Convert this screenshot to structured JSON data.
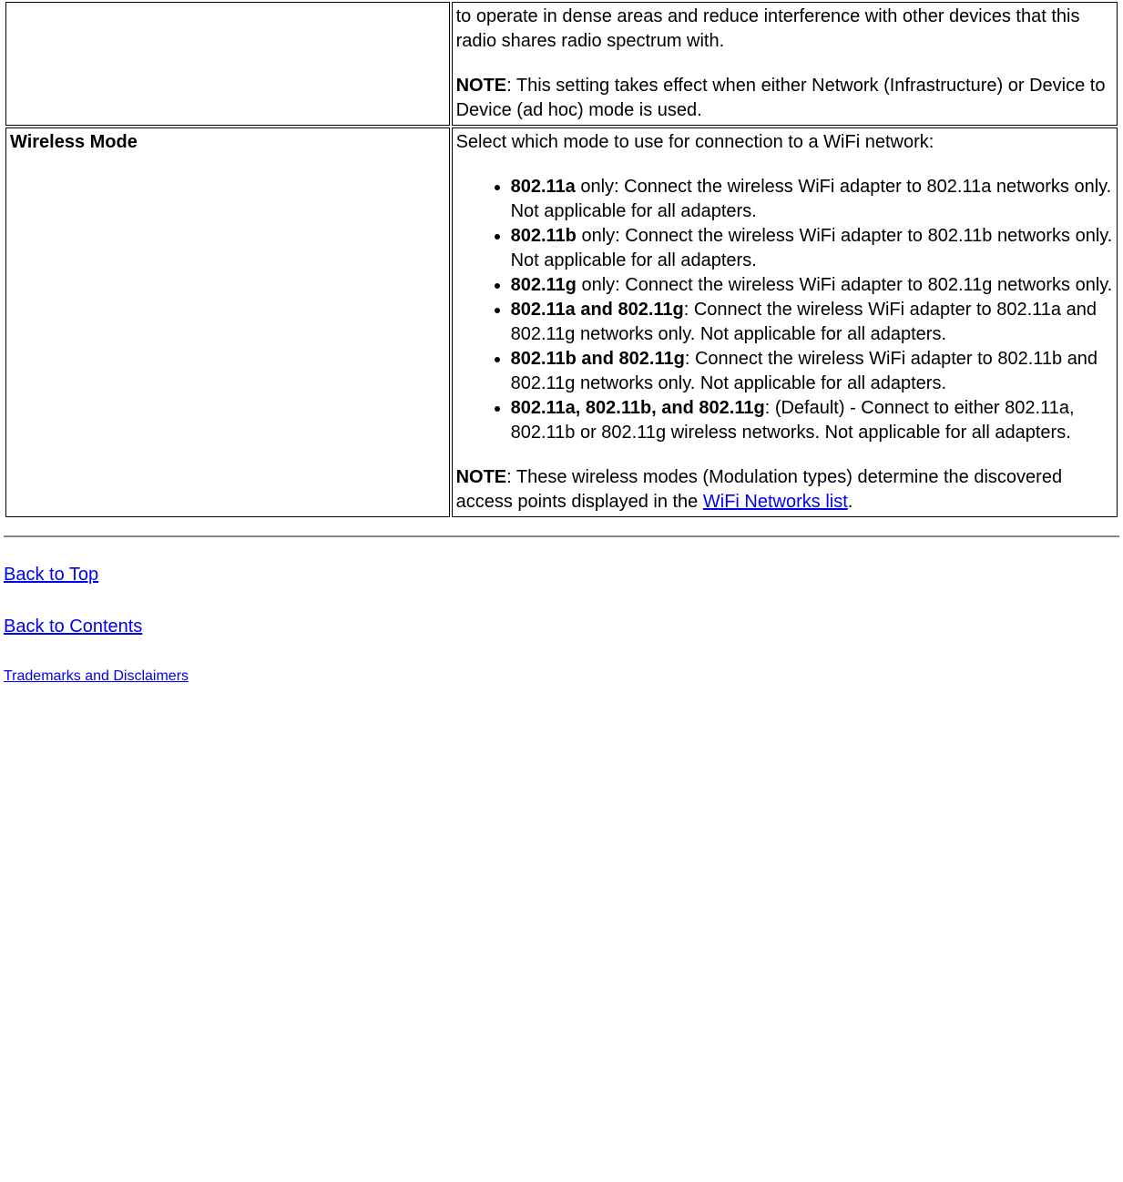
{
  "table": {
    "row1": {
      "name": "",
      "desc_part1": "to operate in dense areas and reduce interference with other devices that this radio shares radio spectrum with.",
      "note_label": "NOTE",
      "note_text": ": This setting takes effect when either Network (Infrastructure) or Device to Device (ad hoc) mode is used."
    },
    "row2": {
      "name": "Wireless Mode",
      "intro": "Select which mode to use for connection to a WiFi network:",
      "items": [
        {
          "bold": "802.11a",
          "rest": " only: Connect the wireless WiFi adapter to 802.11a networks only. Not applicable for all adapters."
        },
        {
          "bold": "802.11b",
          "rest": " only: Connect the wireless WiFi adapter to 802.11b networks only. Not applicable for all adapters."
        },
        {
          "bold": "802.11g",
          "rest": " only: Connect the wireless WiFi adapter to 802.11g networks only."
        },
        {
          "bold": "802.11a and 802.11g",
          "rest": ": Connect the wireless WiFi adapter to 802.11a and 802.11g networks only. Not applicable for all adapters."
        },
        {
          "bold": "802.11b and 802.11g",
          "rest": ": Connect the wireless WiFi adapter to 802.11b and 802.11g networks only. Not applicable for all adapters."
        },
        {
          "bold": "802.11a, 802.11b, and 802.11g",
          "rest": ": (Default) - Connect to either 802.11a, 802.11b or 802.11g wireless networks. Not applicable for all adapters."
        }
      ],
      "note_label": "NOTE",
      "note_text_before": ": These wireless modes (Modulation types) determine the discovered access points displayed in the ",
      "note_link": "WiFi Networks list",
      "note_text_after": "."
    }
  },
  "links": {
    "back_to_top": "Back to Top",
    "back_to_contents": "Back to Contents",
    "trademarks": "Trademarks and Disclaimers"
  }
}
